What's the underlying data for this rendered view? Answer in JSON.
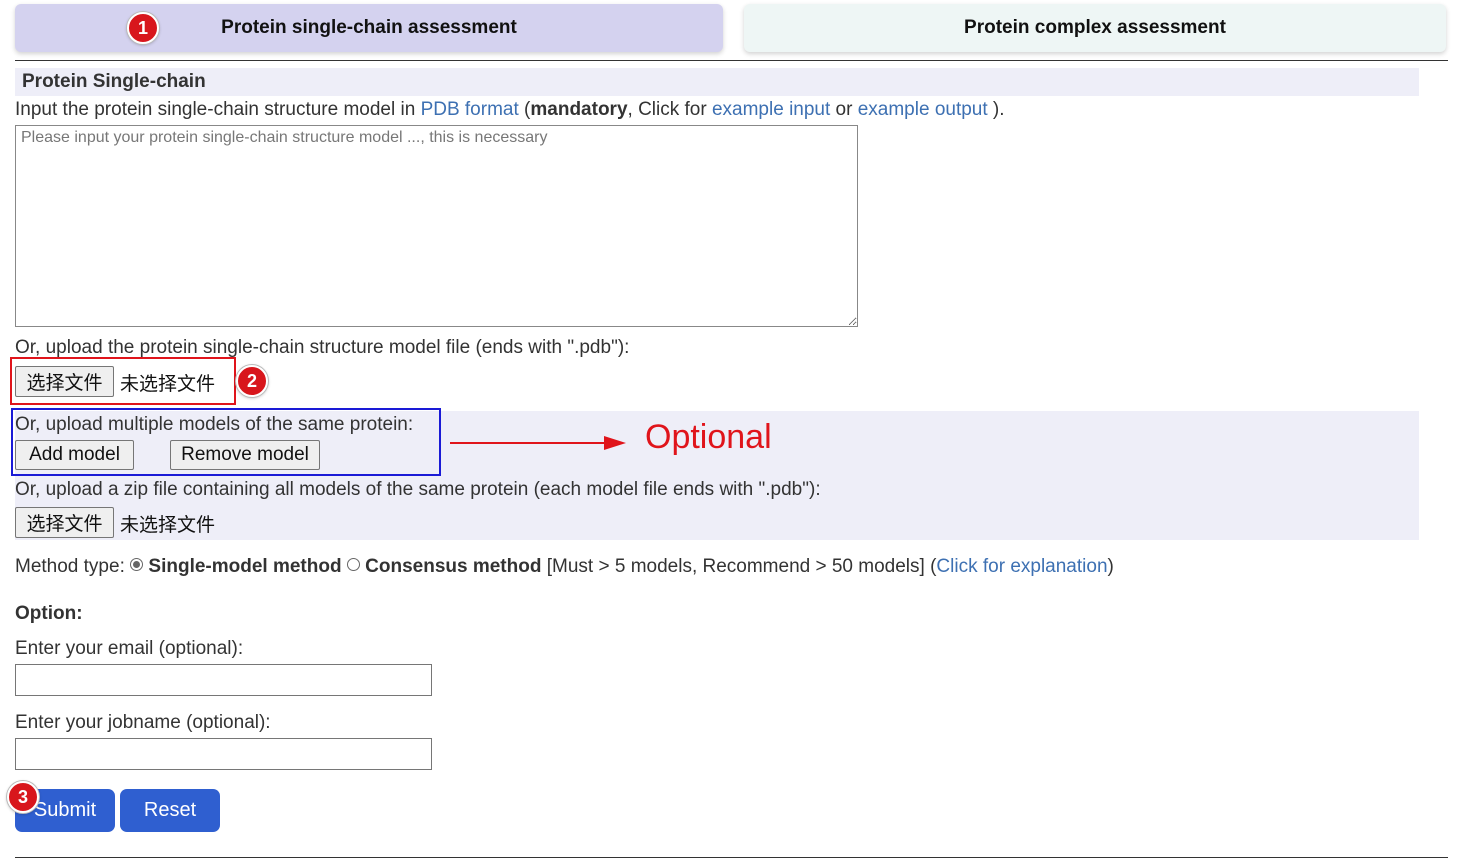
{
  "tabs": [
    {
      "label": "Protein single-chain assessment",
      "active": true
    },
    {
      "label": "Protein complex assessment",
      "active": false
    }
  ],
  "section_title": "Protein Single-chain",
  "intro": {
    "text1": "Input the protein single-chain structure model in ",
    "link_pdb": "PDB format",
    "text2": " (",
    "bold": "mandatory",
    "text3": ", Click for ",
    "link_input": "example input",
    "text4": " or ",
    "link_output": "example output",
    "text5": " )."
  },
  "textarea_placeholder": "Please input your protein single-chain structure model ..., this is necessary",
  "upload_single_label": "Or, upload the protein single-chain structure model file (ends with \".pdb\"):",
  "file_button_label": "选择文件",
  "no_file_label": "未选择文件",
  "multi_label": "Or, upload multiple models of the same protein:",
  "add_model_label": "Add model",
  "remove_model_label": "Remove model",
  "zip_label": "Or, upload a zip file containing all models of the same protein (each model file ends with \".pdb\"):",
  "method": {
    "prefix": "Method type: ",
    "option1": "Single-model method",
    "option1_selected": true,
    "option2": "Consensus method",
    "option2_selected": false,
    "note": " [Must > 5 models, Recommend > 50 models] (",
    "link": "Click for explanation",
    "suffix": ")"
  },
  "option_heading": "Option:",
  "email_label": "Enter your email (optional):",
  "jobname_label": "Enter your jobname (optional):",
  "submit_label": "Submit",
  "reset_label": "Reset",
  "annotations": {
    "marker1": "1",
    "marker2": "2",
    "marker3": "3",
    "optional_text": "Optional",
    "red_color": "#e0141b",
    "blue_color": "#1a1ad6"
  },
  "colors": {
    "active_tab": "#d4d2ef",
    "inactive_tab": "#eef6f5",
    "link": "#3d70b2",
    "button_blue": "#2f5fd0",
    "section_bg": "#eeeef8"
  }
}
